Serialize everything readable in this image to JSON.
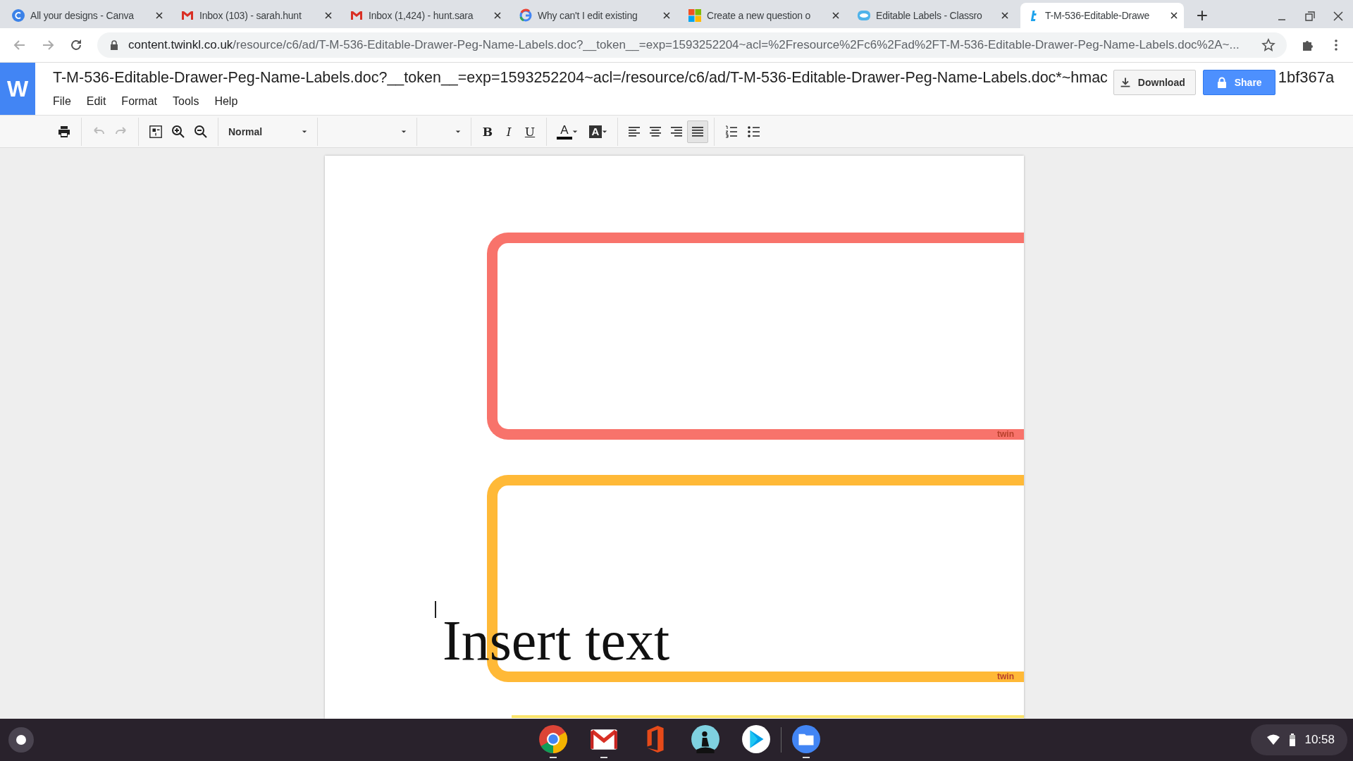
{
  "browser": {
    "tabs": [
      {
        "title": "All your designs - Canva",
        "kind": "canva",
        "selected": false
      },
      {
        "title": "Inbox (103) - sarah.hunt",
        "kind": "gmail",
        "selected": false
      },
      {
        "title": "Inbox (1,424) - hunt.sara",
        "kind": "gmail",
        "selected": false
      },
      {
        "title": "Why can't I edit existing",
        "kind": "google",
        "selected": false
      },
      {
        "title": "Create a new question o",
        "kind": "microsoft",
        "selected": false
      },
      {
        "title": "Editable Labels - Classro",
        "kind": "cloud",
        "selected": false
      },
      {
        "title": "T-M-536-Editable-Drawe",
        "kind": "twinkl",
        "selected": true
      }
    ],
    "new_tab": "+",
    "address": {
      "host": "content.twinkl.co.uk",
      "path": "/resource/c6/ad/T-M-536-Editable-Drawer-Peg-Name-Labels.doc?__token__=exp=1593252204~acl=%2Fresource%2Fc6%2Fad%2FT-M-536-Editable-Drawer-Peg-Name-Labels.doc%2A~..."
    }
  },
  "app": {
    "logo": "W",
    "title": "T-M-536-Editable-Drawer-Peg-Name-Labels.doc?__token__=exp=1593252204~acl=/resource/c6/ad/T-M-536-Editable-Drawer-Peg-Name-Labels.doc*~hmac",
    "title_tail": "1bf367a",
    "menu": [
      "File",
      "Edit",
      "Format",
      "Tools",
      "Help"
    ],
    "download": "Download",
    "share": "Share"
  },
  "toolbar": {
    "undo_disabled": true,
    "redo_disabled": true,
    "style": "Normal",
    "bold": "B",
    "italic": "I",
    "underline": "U",
    "font_color": "A",
    "highlight": "A",
    "align": [
      {
        "kind": "left",
        "selected": false
      },
      {
        "kind": "center",
        "selected": false
      },
      {
        "kind": "right",
        "selected": false
      },
      {
        "kind": "justify",
        "selected": true
      }
    ]
  },
  "document": {
    "labels": [
      {
        "color": "#f8736b",
        "tag": "twin"
      },
      {
        "color": "#ffb937",
        "tag": "twin"
      },
      {
        "color": "#fbe46a"
      }
    ],
    "text": "Insert text"
  },
  "shelf": {
    "apps": [
      {
        "kind": "chrome",
        "running": true
      },
      {
        "kind": "gmail",
        "running": true
      },
      {
        "kind": "office",
        "running": false
      },
      {
        "kind": "reader",
        "running": false
      },
      {
        "kind": "play",
        "running": false
      },
      {
        "kind": "files",
        "running": true
      }
    ],
    "time": "10:58"
  }
}
